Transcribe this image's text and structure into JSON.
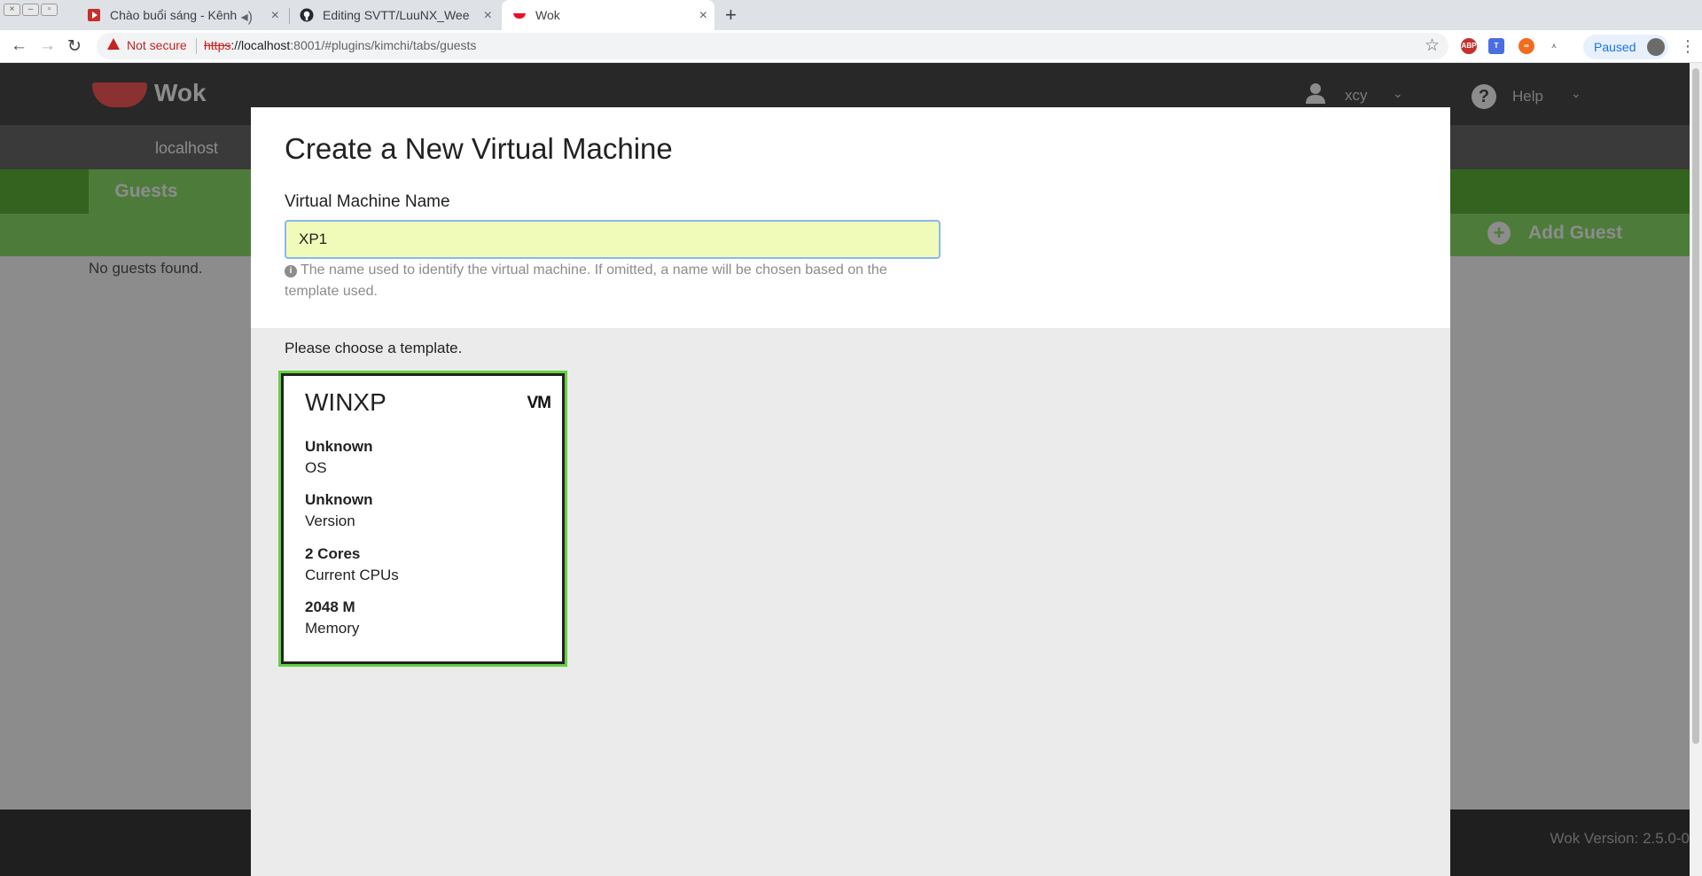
{
  "browser": {
    "tabs": [
      {
        "title": "Chào buổi sáng - Kênh",
        "icon": "youtube-icon"
      },
      {
        "title": "Editing SVTT/LuuNX_Wee",
        "icon": "github-icon"
      },
      {
        "title": "Wok",
        "icon": "wok-icon"
      }
    ],
    "security_label": "Not secure",
    "url_scheme": "https",
    "url_host": "://localhost",
    "url_rest": ":8001/#plugins/kimchi/tabs/guests",
    "extensions": [
      "ABP",
      "T",
      "∞"
    ],
    "profile_status": "Paused"
  },
  "wok": {
    "app_title": "Wok",
    "user": "xcy",
    "help_label": "Help",
    "host": "localhost",
    "active_tab": "Guests",
    "add_guest_label": "Add Guest",
    "empty_message": "No guests found.",
    "version_label": "Wok Version: 2.5.0-0"
  },
  "modal": {
    "title": "Create a New Virtual Machine",
    "vm_name_label": "Virtual Machine Name",
    "vm_name_value": "XP1",
    "vm_name_hint": "The name used to identify the virtual machine. If omitted, a name will be chosen based on the template used.",
    "choose_template_label": "Please choose a template.",
    "templates": [
      {
        "name": "WINXP",
        "badge": "VM",
        "os_value": "Unknown",
        "os_label": "OS",
        "version_value": "Unknown",
        "version_label": "Version",
        "cpu_value": "2 Cores",
        "cpu_label": "Current CPUs",
        "memory_value": "2048 M",
        "memory_label": "Memory"
      }
    ]
  },
  "colors": {
    "wok_green": "#5fb43a",
    "wok_light_green": "#8de06a",
    "input_bg": "#f0fbb9",
    "selected_border": "#63d240",
    "logo_red": "#ff5a5a"
  }
}
